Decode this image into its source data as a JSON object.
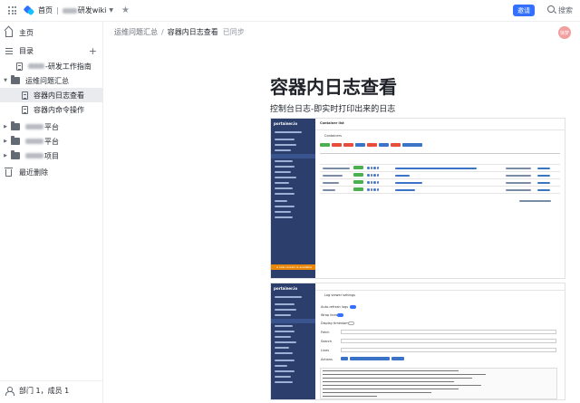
{
  "topbar": {
    "home": "首页",
    "space_suffix": "研发wiki",
    "invite_button": "邀请",
    "search_label": "搜索"
  },
  "sidebar": {
    "home": "主页",
    "toc": "目录",
    "items": [
      {
        "label": "-研发工作指南",
        "indent": 1,
        "type": "doc"
      },
      {
        "label": "运维问题汇总",
        "indent": 0,
        "type": "folder-open"
      },
      {
        "label": "容器内日志查看",
        "indent": 2,
        "type": "doc",
        "active": true
      },
      {
        "label": "容器内命令操作",
        "indent": 2,
        "type": "doc"
      },
      {
        "label": "平台",
        "indent": 0,
        "type": "folder"
      },
      {
        "label": "平台",
        "indent": 0,
        "type": "folder"
      },
      {
        "label": "项目",
        "indent": 0,
        "type": "folder"
      }
    ],
    "trash": "最近删除",
    "members": "部门 1，成员 1"
  },
  "breadcrumb": {
    "parent": "运维问题汇总",
    "current": "容器内日志查看",
    "status": "已同步"
  },
  "avatar_text": "徐梦",
  "document": {
    "title": "容器内日志查看",
    "subtitle": "控制台日志-即实时打印出来的日志"
  },
  "screenshot1": {
    "brand": "portainer.io",
    "panel_title": "Container list",
    "section": "Containers",
    "banner": "A new version is available"
  },
  "screenshot2": {
    "brand": "portainer.io",
    "panel_title": "Log viewer settings",
    "labels": [
      "Auto-refresh logs",
      "Wrap lines",
      "Display timestamps",
      "Fetch",
      "Search",
      "Lines",
      "Actions"
    ]
  },
  "colors": {
    "accent": "#3370ff",
    "portainer_sidebar": "#2c3e6b",
    "banner": "#e8870a"
  }
}
